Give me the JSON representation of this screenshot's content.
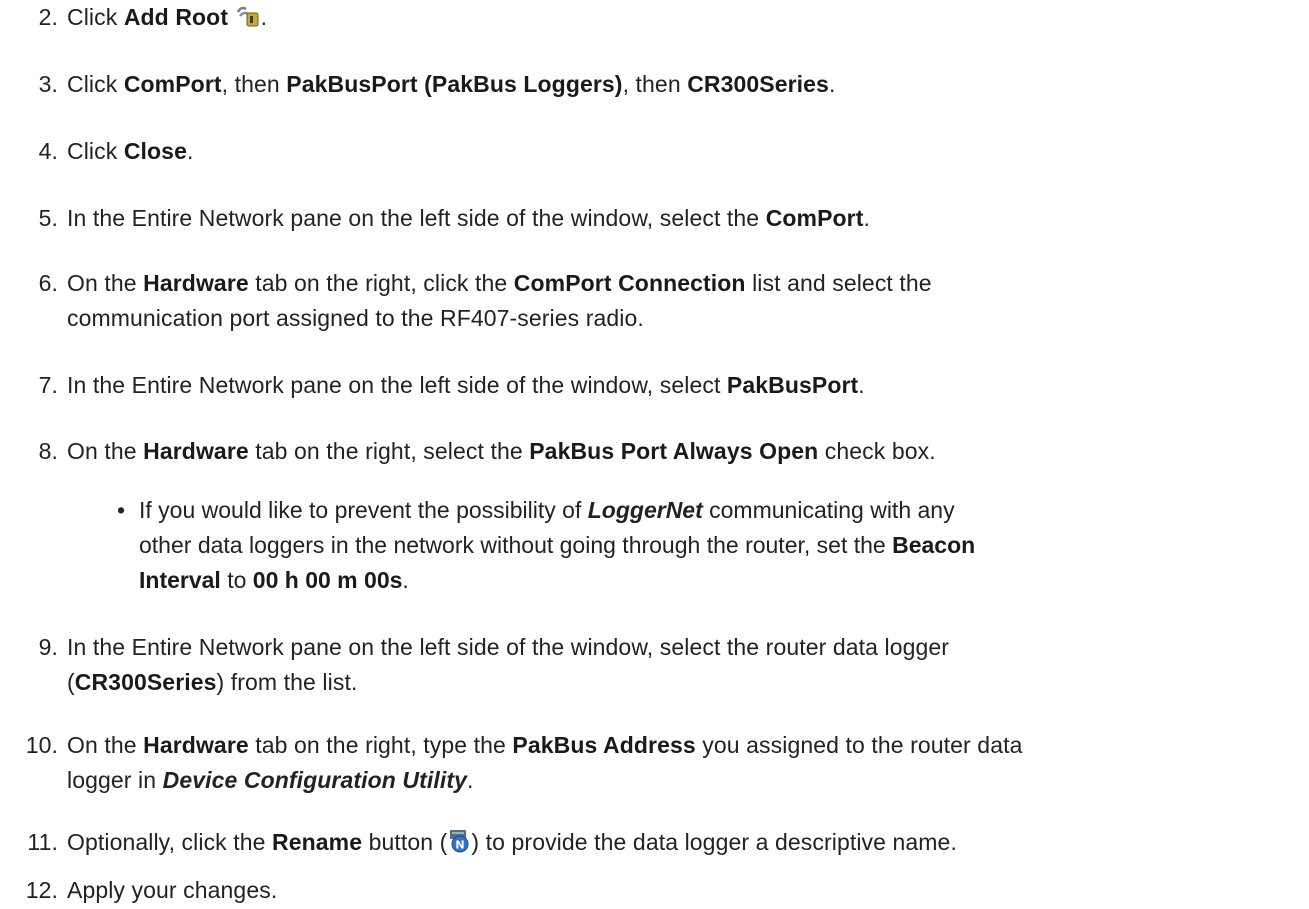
{
  "steps": [
    {
      "num": "2.",
      "parts": {
        "a": "Click ",
        "b": "Add Root",
        "c": "."
      }
    },
    {
      "num": "3.",
      "parts": {
        "a": "Click ",
        "b": "ComPort",
        "c": ", then ",
        "d": "PakBusPort (PakBus Loggers)",
        "e": ", then ",
        "f": "CR300Series",
        "g": "."
      }
    },
    {
      "num": "4.",
      "parts": {
        "a": "Click ",
        "b": "Close",
        "c": "."
      }
    },
    {
      "num": "5.",
      "parts": {
        "a": "In the Entire Network pane on the left side of the window, select the ",
        "b": "ComPort",
        "c": "."
      }
    },
    {
      "num": "6.",
      "parts": {
        "a": "On the ",
        "b": "Hardware",
        "c": " tab on the right, click the ",
        "d": "ComPort Connection",
        "e": " list and select the",
        "f": "communication port assigned to the RF407-series radio."
      }
    },
    {
      "num": "7.",
      "parts": {
        "a": "In the Entire Network pane on the left side of the window, select ",
        "b": "PakBusPort",
        "c": "."
      }
    },
    {
      "num": "8.",
      "parts": {
        "a": "On the ",
        "b": "Hardware",
        "c": " tab on the right, select the ",
        "d": "PakBus Port Always Open",
        "e": " check box."
      }
    },
    {
      "num": "9.",
      "parts": {
        "a": "In the Entire Network pane on the left side of the window, select the router data logger",
        "b": "(",
        "c": "CR300Series",
        "d": ") from the list."
      }
    },
    {
      "num": "10.",
      "parts": {
        "a": "On the ",
        "b": "Hardware",
        "c": " tab on the right, type the ",
        "d": "PakBus Address",
        "e": " you assigned to the router data",
        "f": "logger in ",
        "g": "Device Configuration Utility",
        "h": "."
      }
    },
    {
      "num": "11.",
      "parts": {
        "a": "Optionally, click the ",
        "b": "Rename",
        "c": " button (",
        "d": ") to provide the data logger a descriptive name."
      }
    },
    {
      "num": "12.",
      "parts": {
        "a": "Apply your changes."
      }
    }
  ],
  "bullet": {
    "dot": "•",
    "parts": {
      "a": "If you would like to prevent the possibility of ",
      "b": "LoggerNet",
      "c": " communicating with any",
      "d": "other data loggers in the network without going through the router, set the ",
      "e": "Beacon",
      "f": "Interval",
      "g": " to ",
      "h": "00 h 00 m 00s",
      "i": "."
    }
  },
  "icons": {
    "add_root": "add-root-icon",
    "rename": "rename-icon"
  }
}
